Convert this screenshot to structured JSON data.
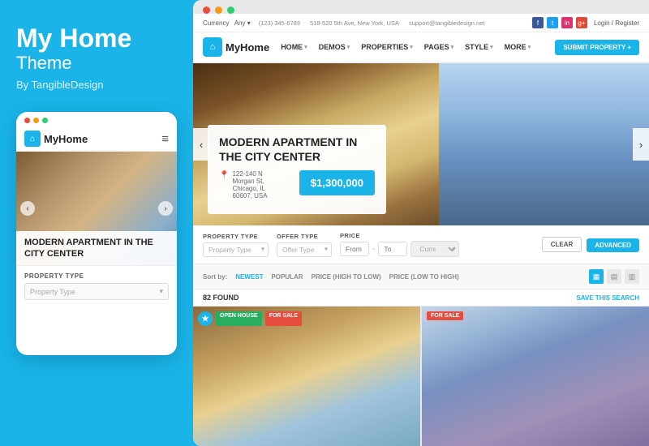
{
  "left": {
    "brand": {
      "title": "My Home",
      "subtitle": "Theme",
      "by": "By TangibleDesign"
    },
    "mobile": {
      "dots": [
        "red",
        "yellow",
        "green"
      ],
      "logo_text": "MyHome",
      "hamburger": "≡",
      "hero_title": "MODERN APARTMENT IN THE CITY CENTER",
      "property_type_label": "PROPERTY TYPE",
      "property_type_placeholder": "Property Type"
    }
  },
  "right": {
    "browser_dots": [
      "red",
      "yellow",
      "green"
    ],
    "topbar": {
      "currency_label": "Currency",
      "currency_value": "Any ▾",
      "phone1": "(123) 345-6789",
      "address": "518-520 5th Ave, New York, USA",
      "email": "support@tangibledesign.net",
      "social": [
        "f",
        "t",
        "in",
        "g+"
      ],
      "login": "Login / Register"
    },
    "nav": {
      "logo": "MyHome",
      "items": [
        {
          "label": "HOME",
          "has_caret": true
        },
        {
          "label": "DEMOS",
          "has_caret": true
        },
        {
          "label": "PROPERTIES",
          "has_caret": true
        },
        {
          "label": "PAGES",
          "has_caret": true
        },
        {
          "label": "STYLE",
          "has_caret": true
        },
        {
          "label": "MORE",
          "has_caret": true
        }
      ],
      "submit_btn": "SUBMIT PROPERTY +"
    },
    "hero": {
      "title_line1": "MODERN APARTMENT IN",
      "title_line2": "THE CITY CENTER",
      "address_line1": "122-140 N Morgan St,",
      "address_line2": "Chicago, IL 60607, USA",
      "price": "$1,300,000"
    },
    "search": {
      "property_type_label": "PROPERTY TYPE",
      "property_type_placeholder": "Property Type",
      "offer_type_label": "OFFER TYPE",
      "offer_type_placeholder": "Offer Type",
      "price_label": "PRICE",
      "price_from": "From",
      "price_dash": "-",
      "price_to": "To",
      "price_currency": "Currency ▾",
      "btn_clear": "CLEAR",
      "btn_advanced": "ADVANCED"
    },
    "results": {
      "sort_label": "Sort by:",
      "sort_items": [
        {
          "label": "NEWEST",
          "active": true
        },
        {
          "label": "POPULAR",
          "active": false
        },
        {
          "label": "PRICE (HIGH TO LOW)",
          "active": false
        },
        {
          "label": "PRICE (LOW TO HIGH)",
          "active": false
        }
      ],
      "view_icons": [
        "▦",
        "▤",
        "▥"
      ],
      "found_count": "82 FOUND",
      "save_search": "SAVE THIS SEARCH"
    },
    "cards": [
      {
        "badges": [
          "OPEN HOUSE",
          "FOR SALE"
        ],
        "has_star": true,
        "img_type": "left"
      },
      {
        "badges": [
          "FOR SALE"
        ],
        "has_star": false,
        "img_type": "right"
      }
    ]
  }
}
